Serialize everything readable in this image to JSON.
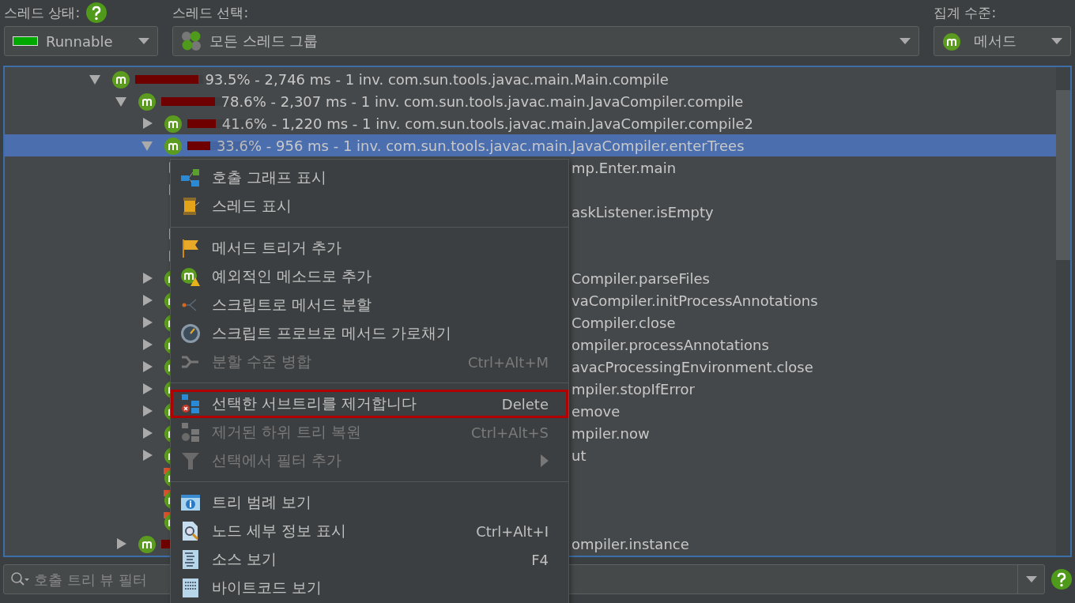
{
  "toolbar": {
    "thread_status": {
      "label": "스레드 상태:",
      "value": "Runnable"
    },
    "thread_selection": {
      "label": "스레드 선택:",
      "value": "모든 스레드 그룹"
    },
    "aggregation": {
      "label": "집계 수준:",
      "value": "메서드"
    }
  },
  "call_tree": {
    "rows": [
      {
        "text": "93.5% - 2,746 ms - 1 inv. com.sun.tools.javac.main.Main.compile",
        "level": 0.935,
        "expanded": true,
        "selected": false,
        "kind": "method",
        "children": [
          {
            "text": "78.6% - 2,307 ms - 1 inv. com.sun.tools.javac.main.JavaCompiler.compile",
            "level": 0.786,
            "expanded": true,
            "selected": false,
            "kind": "method",
            "children": [
              {
                "text": "41.6% - 1,220 ms - 1 inv. com.sun.tools.javac.main.JavaCompiler.compile2",
                "level": 0.416,
                "expanded": false,
                "selected": false,
                "kind": "method"
              },
              {
                "text": "33.6% - 956 ms - 1 inv. com.sun.tools.javac.main.JavaCompiler.enterTrees",
                "level": 0.336,
                "expanded": true,
                "selected": true,
                "kind": "method",
                "children": [
                  {
                    "text": "mp.Enter.main",
                    "expanded": false,
                    "selected": false
                  },
                  {
                    "expanded": false,
                    "selected": false
                  },
                  {
                    "text": "askListener.isEmpty",
                    "selected": false
                  },
                  {
                    "expanded": false,
                    "selected": false
                  },
                  {
                    "expanded": false,
                    "selected": false
                  }
                ]
              },
              {
                "text": "Compiler.parseFiles",
                "expanded": false,
                "selected": false,
                "kind": "method"
              },
              {
                "text": "vaCompiler.initProcessAnnotations",
                "expanded": false,
                "selected": false,
                "kind": "method"
              },
              {
                "text": "Compiler.close",
                "expanded": false,
                "selected": false,
                "kind": "method"
              },
              {
                "text": "ompiler.processAnnotations",
                "expanded": false,
                "selected": false,
                "kind": "method"
              },
              {
                "text": "avacProcessingEnvironment.close",
                "expanded": false,
                "selected": false,
                "kind": "method"
              },
              {
                "text": "mpiler.stopIfError",
                "expanded": false,
                "selected": false,
                "kind": "method"
              },
              {
                "text": "emove",
                "expanded": false,
                "selected": false,
                "kind": "method"
              },
              {
                "text": "mpiler.now",
                "expanded": false,
                "selected": false,
                "kind": "method"
              },
              {
                "text": "ut",
                "expanded": false,
                "selected": false,
                "kind": "method"
              },
              {
                "selected": false,
                "kind": "flagged"
              },
              {
                "selected": false,
                "kind": "flagged"
              },
              {
                "selected": false,
                "kind": "flagged"
              }
            ]
          },
          {
            "text": "ompiler.instance",
            "level": 0.15,
            "expanded": false,
            "selected": false,
            "kind": "method"
          }
        ]
      }
    ]
  },
  "context_menu": {
    "groups": [
      [
        {
          "kind": "graph",
          "label": "호출 그래프 표시",
          "disabled": false,
          "highlighted": false
        },
        {
          "kind": "spool",
          "label": "스레드 표시",
          "disabled": false,
          "highlighted": false
        }
      ],
      [
        {
          "kind": "flag",
          "label": "메서드 트리거 추가",
          "disabled": false,
          "highlighted": false
        },
        {
          "kind": "method-warning",
          "label": "예외적인 메소드로 추가",
          "disabled": false,
          "highlighted": false
        },
        {
          "kind": "split",
          "label": "스크립트로 메서드 분할",
          "disabled": false,
          "highlighted": false
        },
        {
          "kind": "gauge",
          "label": "스크립트 프로브로 메서드 가로채기",
          "disabled": false,
          "highlighted": false
        },
        {
          "kind": "merge",
          "label": "분할 수준 병합",
          "shortcut": "Ctrl+Alt+M",
          "disabled": true,
          "highlighted": false
        }
      ],
      [
        {
          "kind": "remove-tree",
          "label": "선택한 서브트리를 제거합니다",
          "shortcut": "Delete",
          "disabled": false,
          "highlighted": true
        },
        {
          "kind": "restore-tree",
          "label": "제거된 하위 트리 복원",
          "shortcut": "Ctrl+Alt+S",
          "disabled": true,
          "highlighted": false
        },
        {
          "kind": "funnel",
          "label": "선택에서 필터 추가",
          "disabled": true,
          "highlighted": false,
          "submenu": true
        }
      ],
      [
        {
          "kind": "info",
          "label": "트리 범례 보기",
          "disabled": false,
          "highlighted": false
        },
        {
          "kind": "magnifier",
          "label": "노드 세부 정보 표시",
          "shortcut": "Ctrl+Alt+I",
          "disabled": false,
          "highlighted": false
        },
        {
          "kind": "source",
          "label": "소스 보기",
          "shortcut": "F4",
          "disabled": false,
          "highlighted": false
        },
        {
          "kind": "bytecode",
          "label": "바이트코드 보기",
          "disabled": false,
          "highlighted": false
        }
      ]
    ]
  },
  "filter": {
    "placeholder": "호출 트리 뷰 필터"
  }
}
